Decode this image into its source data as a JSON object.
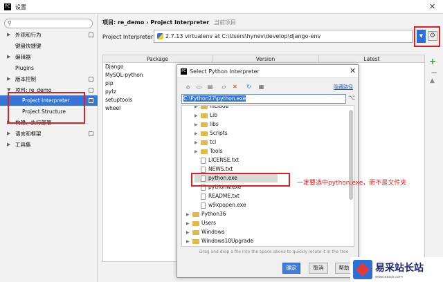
{
  "window": {
    "title": "设置",
    "app_icon": "PC"
  },
  "sidebar": {
    "items": [
      {
        "label": "外观和行为",
        "arrow": "▶"
      },
      {
        "label": "键盘快捷键",
        "arrow": ""
      },
      {
        "label": "编辑器",
        "arrow": "▶"
      },
      {
        "label": "Plugins",
        "arrow": ""
      },
      {
        "label": "版本控制",
        "arrow": "▶"
      },
      {
        "label": "项目: re_demo",
        "arrow": "▼"
      },
      {
        "label": "Project Interpreter",
        "arrow": ""
      },
      {
        "label": "Project Structure",
        "arrow": ""
      },
      {
        "label": "构建、执行部署",
        "arrow": "▶"
      },
      {
        "label": "语言和框架",
        "arrow": "▶"
      },
      {
        "label": "工具集",
        "arrow": "▶"
      }
    ]
  },
  "main": {
    "breadcrumb": "项目: re_demo › Project Interpreter",
    "breadcrumb_sub": "当前项目",
    "interpreter_label": "Project Interpreter:",
    "interpreter_value": "2.7.13 virtualenv at C:\\Users\\hynev\\develop\\django-env"
  },
  "table": {
    "columns": [
      "Package",
      "Version",
      "Latest"
    ],
    "packages": [
      "Django",
      "MySQL-python",
      "pip",
      "pytz",
      "setuptools",
      "wheel"
    ]
  },
  "dialog": {
    "title": "Select Python Interpreter",
    "hide_path": "隐藏路径",
    "path": "C:\\Python27\\python.exe",
    "tree": [
      {
        "label": "include",
        "kind": "folder",
        "level": 2
      },
      {
        "label": "Lib",
        "kind": "folder",
        "level": 2
      },
      {
        "label": "libs",
        "kind": "folder",
        "level": 2
      },
      {
        "label": "Scripts",
        "kind": "folder",
        "level": 2
      },
      {
        "label": "tcl",
        "kind": "folder",
        "level": 2
      },
      {
        "label": "Tools",
        "kind": "folder",
        "level": 2
      },
      {
        "label": "LICENSE.txt",
        "kind": "file",
        "level": 2
      },
      {
        "label": "NEWS.txt",
        "kind": "file",
        "level": 2
      },
      {
        "label": "python.exe",
        "kind": "file",
        "level": 2,
        "selected": true
      },
      {
        "label": "pythonw.exe",
        "kind": "file",
        "level": 2
      },
      {
        "label": "README.txt",
        "kind": "file",
        "level": 2
      },
      {
        "label": "w9xpopen.exe",
        "kind": "file",
        "level": 2
      },
      {
        "label": "Python36",
        "kind": "folder",
        "level": 1
      },
      {
        "label": "Users",
        "kind": "folder",
        "level": 1
      },
      {
        "label": "Windows",
        "kind": "folder",
        "level": 1
      },
      {
        "label": "Windows10Upgrade",
        "kind": "folder",
        "level": 1
      }
    ],
    "hint": "Drag and drop a file into the space above to quickly locate it in the tree",
    "ok": "确定",
    "cancel": "取消",
    "help": "帮助"
  },
  "annotation": "一定要选中python.exe，而不是文件夹",
  "watermark": {
    "text": "易采站长站",
    "url": "www.easck.com"
  },
  "colors": {
    "accent": "#3875d7",
    "highlight": "#e02020"
  }
}
